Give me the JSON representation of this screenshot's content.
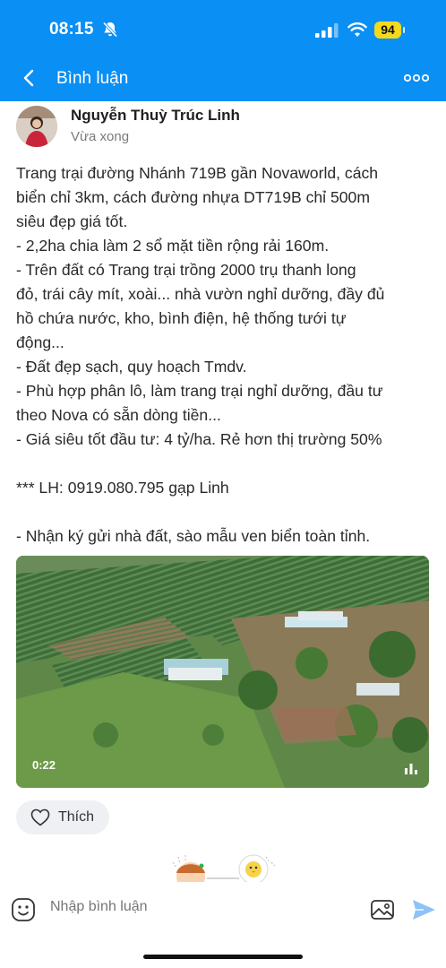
{
  "status_bar": {
    "time": "08:15",
    "battery": "94"
  },
  "nav": {
    "title": "Bình luận"
  },
  "post": {
    "author": "Nguyễn Thuỳ Trúc Linh",
    "posted": "Vừa xong",
    "lines": [
      "Trang trại đường Nhánh 719B gần Novaworld, cách",
      "biển chỉ 3km, cách đường nhựa DT719B chỉ 500m",
      "siêu đẹp giá tốt.",
      "- 2,2ha chia làm 2 sổ mặt tiền rộng rải 160m.",
      "- Trên đất có Trang trại trồng 2000 trụ thanh long",
      "đỏ, trái cây mít, xoài... nhà vườn nghỉ dưỡng, đầy đủ",
      "hồ chứa nước, kho, bình điện, hệ thống tưới tự",
      "động...",
      "- Đất đẹp sạch, quy hoạch Tmdv.",
      "- Phù hợp phân lô, làm trang trại nghỉ dưỡng, đầu tư",
      "theo Nova có sẵn dòng tiền...",
      "- Giá siêu tốt đầu tư: 4 tỷ/ha. Rẻ hơn thị trường 50%",
      "*** LH: 0919.080.795 gạp Linh",
      "- Nhận ký gửi nhà đất, sào mẫu ven biển toàn tỉnh."
    ],
    "video_duration": "0:22",
    "like_label": "Thích"
  },
  "compose": {
    "placeholder": "Nhập bình luận"
  },
  "colors": {
    "header": "#0a8ff5",
    "send": "#8fc3f5"
  }
}
